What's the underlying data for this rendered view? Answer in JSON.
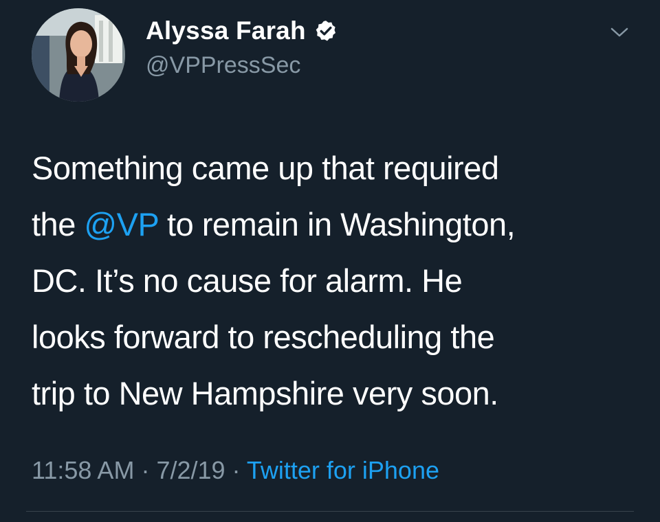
{
  "tweet": {
    "author": {
      "display_name": "Alyssa Farah",
      "handle": "@VPPressSec",
      "verified": true,
      "avatar_icon": "profile-photo"
    },
    "body": {
      "line1": "Something came up that required",
      "line2_before": "the ",
      "mention": "@VP",
      "line2_after": " to remain in Washington,",
      "line3": "DC. It’s no cause for alarm. He",
      "line4": "looks forward to rescheduling the",
      "line5": "trip to New Hampshire very soon."
    },
    "meta": {
      "time": "11:58 AM",
      "separator": " · ",
      "date": "7/2/19",
      "source": "Twitter for iPhone"
    },
    "menu_icon": "chevron-down-icon"
  },
  "colors": {
    "background": "#15202b",
    "link": "#1da1f2",
    "secondary_text": "#8899a6",
    "divider": "#38444d"
  }
}
